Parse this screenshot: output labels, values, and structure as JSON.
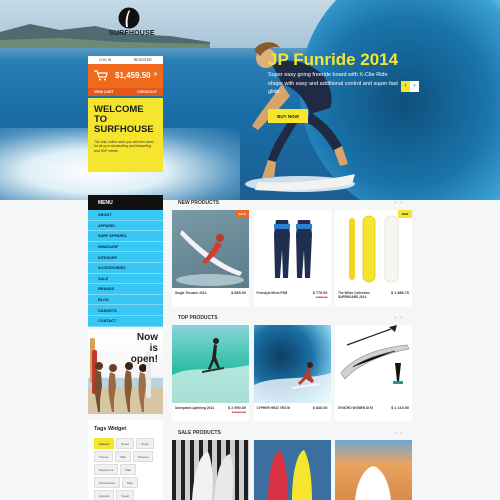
{
  "brand": {
    "name": "SURFHOUSE"
  },
  "account": {
    "login": "LOG IN",
    "register": "REGISTER"
  },
  "cart": {
    "total": "$1,459.50",
    "view_cart": "VIEW CART",
    "checkout": "CHECKOUT",
    "close": "✕"
  },
  "welcome": {
    "title": "WELCOME TO SURFHOUSE",
    "text": "The only online store you will ever need for all your windsurfing and kitesurfing and SUP needs"
  },
  "hero": {
    "title": "JP Funride 2014",
    "text": "Super easy going freeride board with X-Cite Ride shape with easy and additional control and super-fast glide.",
    "button": "BUY NOW",
    "prev": "‹",
    "next": "›"
  },
  "menu": {
    "header": "MENU",
    "items": [
      "ABOUT",
      "APPAREL",
      "SURF APPAREL",
      "WINDSURF",
      "KITESURF",
      "ACCESSORIES",
      "SALE",
      "BRANDS",
      "BLOG",
      "GADGETS",
      "CONTACT"
    ]
  },
  "promo": {
    "line1": "Now",
    "line2": "is",
    "line3": "open!"
  },
  "tags_widget": {
    "title": "Tags Widget",
    "tags": [
      "Kitesurf",
      "Super",
      "Super",
      "Theme",
      "Man",
      "Women",
      "Equipment",
      "Man",
      "Accessories",
      "Man",
      "Apparel",
      "Super"
    ]
  },
  "sections": {
    "new": {
      "title": "NEW PRODUCTS",
      "products": [
        {
          "name": "Single Thruster 2014",
          "price": "$ 865.00",
          "old": "",
          "badge": "SALE"
        },
        {
          "name": "Freestyle Mens FSM",
          "price": "$ 770.00",
          "old": "$ 870.00",
          "badge": ""
        },
        {
          "name": "The White Collection SURFBOARD 2014",
          "price": "$ 1 886.70",
          "old": "",
          "badge": "NEW"
        }
      ]
    },
    "top": {
      "title": "TOP PRODUCTS",
      "products": [
        {
          "name": "Unimplant Lightning 2014",
          "price": "$ 2 990.00",
          "old": "$ 3 190.00",
          "badge": ""
        },
        {
          "name": "CYPHER HEAT VES M",
          "price": "$ 840.00",
          "old": "",
          "badge": ""
        },
        {
          "name": "SYNCRO WOMEN DI M",
          "price": "$ 1 110.00",
          "old": "",
          "badge": ""
        }
      ]
    },
    "sale": {
      "title": "SALE PRODUCTS"
    }
  },
  "colors": {
    "accent": "#f6e52f",
    "orange": "#f06a1d",
    "menu": "#38c7f3"
  }
}
